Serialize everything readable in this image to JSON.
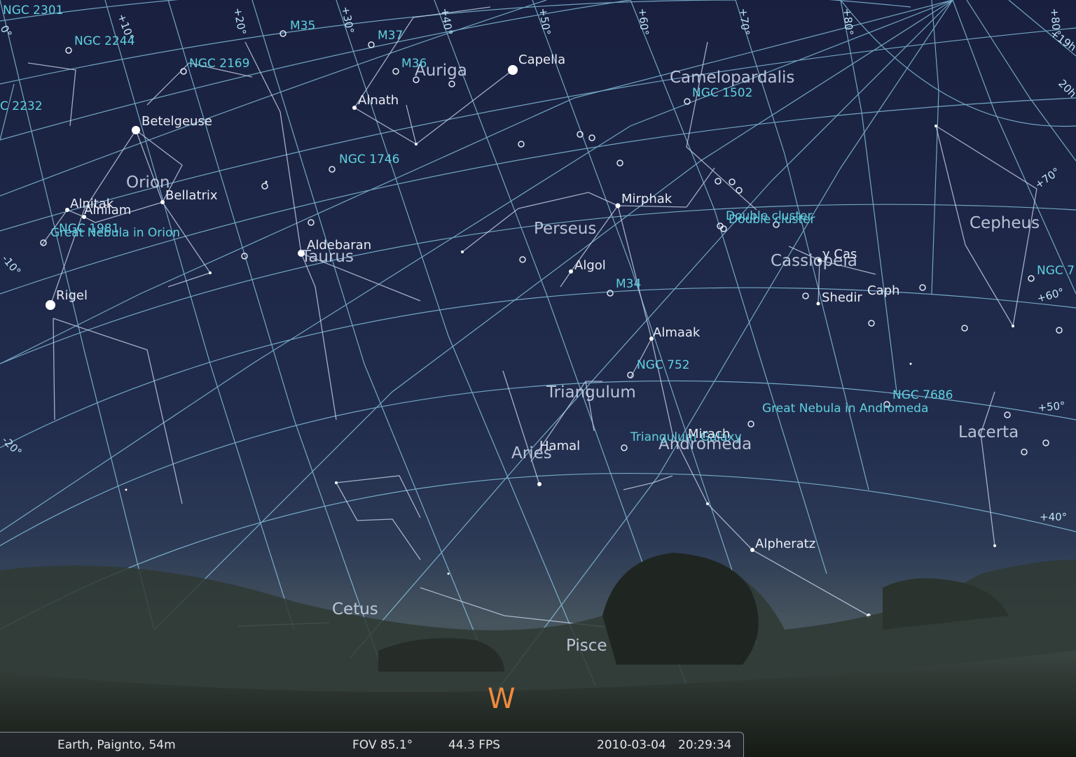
{
  "app": {
    "status_bar": {
      "location": "Earth, Paignto, 54m",
      "fov": "FOV 85.1°",
      "fps": "44.3 FPS",
      "date": "2010-03-04",
      "time": "20:29:34"
    },
    "compass": {
      "west": "W"
    }
  },
  "stars": [
    {
      "id": "capella",
      "label": "Capella"
    },
    {
      "id": "betelgeuse",
      "label": "Betelgeuse"
    },
    {
      "id": "rigel",
      "label": "Rigel"
    },
    {
      "id": "aldebaran",
      "label": "Aldebaran"
    },
    {
      "id": "bellatrix",
      "label": "Bellatrix"
    },
    {
      "id": "alnitak",
      "label": "Alnitak"
    },
    {
      "id": "alnilam",
      "label": "Alnilam"
    },
    {
      "id": "alnath",
      "label": "Alnath"
    },
    {
      "id": "mirphak",
      "label": "Mirphak"
    },
    {
      "id": "algol",
      "label": "Algol"
    },
    {
      "id": "almaak",
      "label": "Almaak"
    },
    {
      "id": "hamal",
      "label": "Hamal"
    },
    {
      "id": "mirach",
      "label": "Mirach"
    },
    {
      "id": "alpheratz",
      "label": "Alpheratz"
    },
    {
      "id": "shedir",
      "label": "Shedir"
    },
    {
      "id": "caph",
      "label": "Caph"
    },
    {
      "id": "gamma-cas",
      "label": "γ Cas"
    }
  ],
  "dsos": [
    {
      "id": "ngc2301",
      "label": "NGC 2301"
    },
    {
      "id": "ngc2244",
      "label": "NGC 2244"
    },
    {
      "id": "ngc2232",
      "label": "C 2232"
    },
    {
      "id": "ngc2169",
      "label": "NGC 2169"
    },
    {
      "id": "m35",
      "label": "M35"
    },
    {
      "id": "m37",
      "label": "M37"
    },
    {
      "id": "m36",
      "label": "M36"
    },
    {
      "id": "ngc1746",
      "label": "NGC 1746"
    },
    {
      "id": "ngc1502",
      "label": "NGC 1502"
    },
    {
      "id": "ngc1981",
      "label": "NGC 1981"
    },
    {
      "id": "orion-nebula",
      "label": "Great Nebula in Orion"
    },
    {
      "id": "double-cluster-1",
      "label": "Double cluster"
    },
    {
      "id": "double-cluster-2",
      "label": "Double cluster"
    },
    {
      "id": "m34",
      "label": "M34"
    },
    {
      "id": "ngc752",
      "label": "NGC 752"
    },
    {
      "id": "ngc7686",
      "label": "NGC 7686"
    },
    {
      "id": "andromeda-nebula",
      "label": "Great Nebula in Andromeda"
    },
    {
      "id": "triangulum-galaxy",
      "label": "Triangulum Galaxy"
    },
    {
      "id": "ngc7x",
      "label": "NGC 7"
    }
  ],
  "constellations": [
    {
      "id": "auriga",
      "label": "Auriga"
    },
    {
      "id": "orion",
      "label": "Orion"
    },
    {
      "id": "taurus",
      "label": "Taurus"
    },
    {
      "id": "perseus",
      "label": "Perseus"
    },
    {
      "id": "camelopardalis",
      "label": "Camelopardalis"
    },
    {
      "id": "cassiopeia",
      "label": "Cassiopeia"
    },
    {
      "id": "cepheus",
      "label": "Cepheus"
    },
    {
      "id": "triangulum",
      "label": "Triangulum"
    },
    {
      "id": "aries",
      "label": "Aries"
    },
    {
      "id": "andromeda",
      "label": "Andromeda"
    },
    {
      "id": "lacerta",
      "label": "Lacerta"
    },
    {
      "id": "cetus",
      "label": "Cetus"
    },
    {
      "id": "pisces",
      "label": "Pisce"
    }
  ],
  "grid_labels": [
    {
      "id": "dec-p10",
      "label": "+10°"
    },
    {
      "id": "dec-p20",
      "label": "+20°"
    },
    {
      "id": "dec-p30",
      "label": "+30°"
    },
    {
      "id": "dec-p40-top",
      "label": "+40°"
    },
    {
      "id": "dec-p50-top",
      "label": "+50°"
    },
    {
      "id": "dec-p60-top",
      "label": "+60°"
    },
    {
      "id": "dec-p70-top",
      "label": "+70°"
    },
    {
      "id": "dec-p80-top",
      "label": "+80°"
    },
    {
      "id": "dec-p80-right",
      "label": "+80°"
    },
    {
      "id": "ra-19h",
      "label": "+19h"
    },
    {
      "id": "ra-20h",
      "label": "20h"
    },
    {
      "id": "dec-p70-right",
      "label": "+70°"
    },
    {
      "id": "dec-p60-right",
      "label": "+60°"
    },
    {
      "id": "dec-p50-right",
      "label": "+50°"
    },
    {
      "id": "dec-p40-right",
      "label": "+40°"
    },
    {
      "id": "dec-m10",
      "label": "-10°"
    },
    {
      "id": "dec-m20",
      "label": "-20°"
    },
    {
      "id": "dec-0",
      "label": "0°"
    }
  ],
  "colors": {
    "sky_top": "#1a2245",
    "sky_mid": "#243050",
    "horizon": "#3e4a52",
    "grid": "#8fd2ee",
    "constellation_lines": "#c4d0e6",
    "star_label": "#e8ecf4",
    "dso_label": "#5fd0e0",
    "compass": "#f08a3c"
  }
}
